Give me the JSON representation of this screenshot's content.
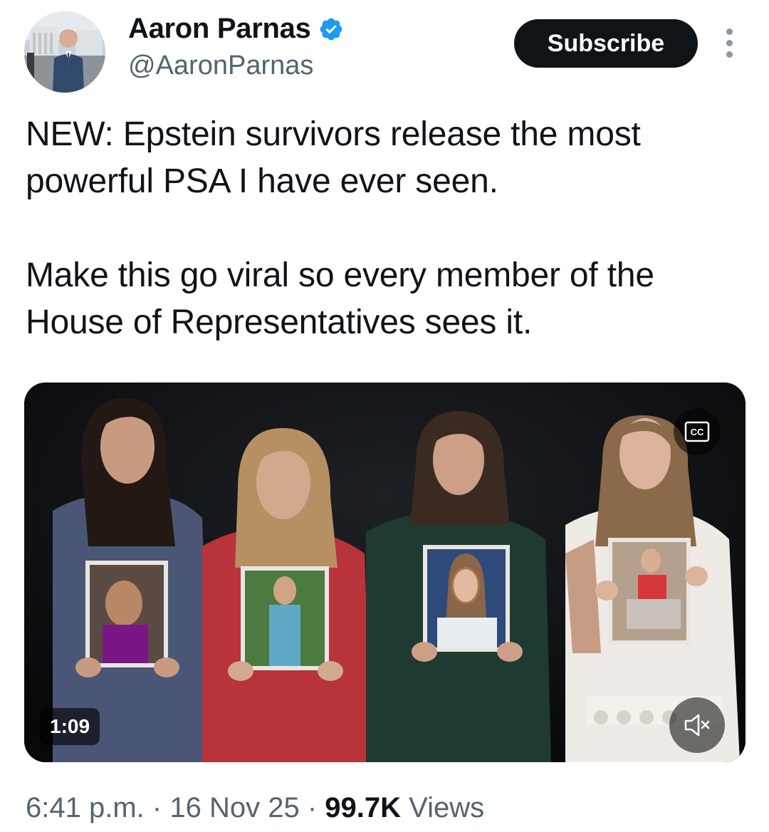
{
  "author": {
    "name": "Aaron Parnas",
    "handle": "@AaronParnas",
    "verified": true,
    "verified_color": "#1d9bf0"
  },
  "header": {
    "subscribe_label": "Subscribe",
    "more_icon": "more-vertical-icon"
  },
  "tweet": {
    "paragraphs": [
      "NEW: Epstein survivors release the most powerful PSA I have ever seen.",
      "Make this go viral so every member of the House of Representatives sees it."
    ]
  },
  "media": {
    "type": "video",
    "cc_label": "CC",
    "duration": "1:09",
    "mute_icon": "volume-muted-icon"
  },
  "meta": {
    "time": "6:41 p.m.",
    "separator": "·",
    "date": "16 Nov 25",
    "views_count": "99.7K",
    "views_label": "Views"
  },
  "colors": {
    "text_primary": "#0f1419",
    "text_secondary": "#536471",
    "button_bg": "#0f1419"
  }
}
